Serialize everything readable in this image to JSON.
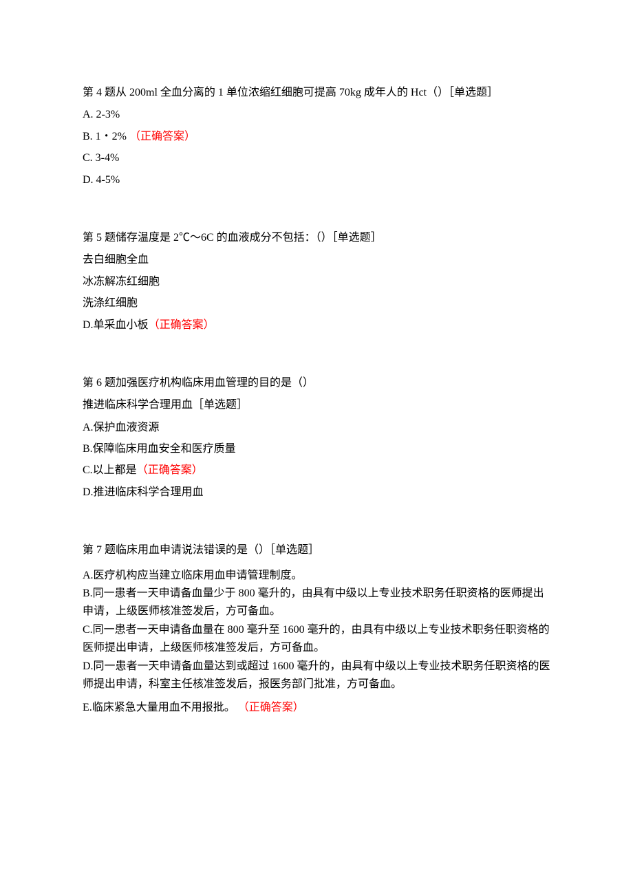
{
  "q4": {
    "question": "第 4 题从 200ml 全血分离的 1 单位浓缩红细胞可提高 70kg 成年人的 Hct（）［单选题］",
    "optA": "A.   2-3%",
    "optB_text": "B.   1・2% ",
    "optB_correct": "（正确答案）",
    "optC": "C.   3-4%",
    "optD": "D.   4-5%"
  },
  "q5": {
    "question": "第 5 题储存温度是 2℃〜6C 的血液成分不包括：（）［单选题］",
    "optA": "去白细胞全血",
    "optB": "冰冻解冻红细胞",
    "optC": "洗涤红细胞",
    "optD_text": "D.单采血小板",
    "optD_correct": "（正确答案）"
  },
  "q6": {
    "question_line1": "第 6 题加强医疗机构临床用血管理的目的是（）",
    "question_line2": "推进临床科学合理用血［单选题］",
    "optA": "A.保护血液资源",
    "optB": "B.保障临床用血安全和医疗质量",
    "optC_text": "C.以上都是",
    "optC_correct": "（正确答案）",
    "optD": "D.推进临床科学合理用血"
  },
  "q7": {
    "question": "第 7 题临床用血申请说法错误的是（）［单选题］",
    "optA": "A.医疗机构应当建立临床用血申请管理制度。",
    "optB": "B.同一患者一天申请备血量少于 800 毫升的，由具有中级以上专业技术职务任职资格的医师提出申请，上级医师核准签发后，方可备血。",
    "optC": "C.同一患者一天申请备血量在 800 毫升至 1600 毫升的，由具有中级以上专业技术职务任职资格的医师提出申请，上级医师核准签发后，方可备血。",
    "optD": "D.同一患者一天申请备血量达到或超过 1600 毫升的，由具有中级以上专业技术职务任职资格的医师提出申请，科室主任核准签发后，报医务部门批准，方可备血。",
    "optE_text": "E.临床紧急大量用血不用报批。 ",
    "optE_correct": "（正确答案）"
  }
}
